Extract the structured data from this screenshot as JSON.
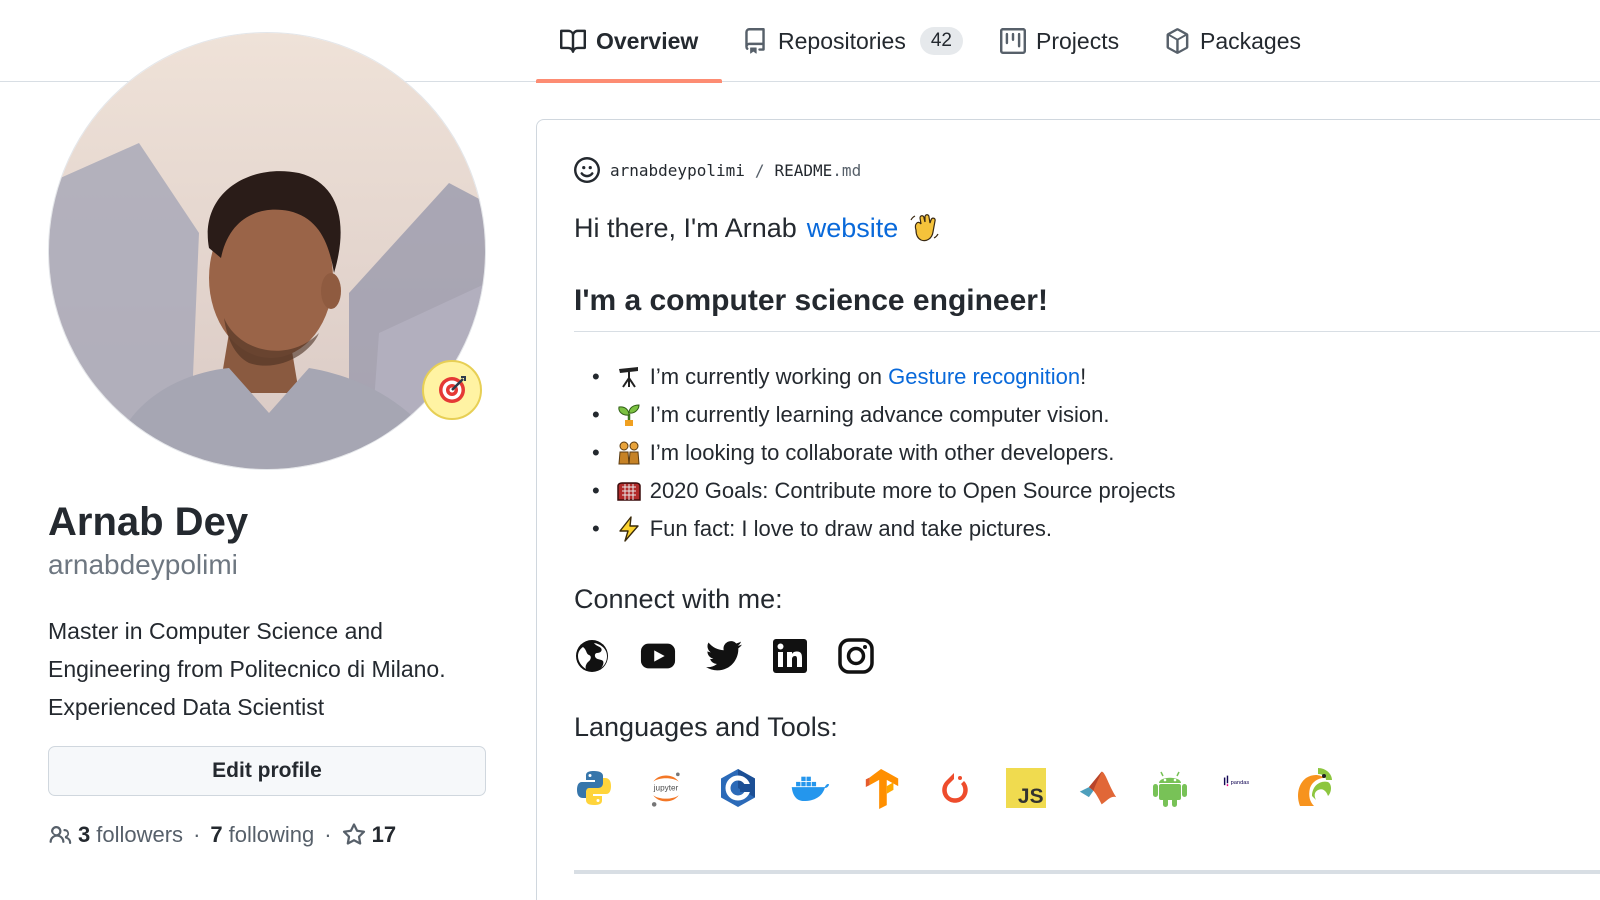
{
  "nav": {
    "tabs": [
      {
        "label": "Overview",
        "icon": "book-icon",
        "active": true
      },
      {
        "label": "Repositories",
        "icon": "repo-icon",
        "count": "42"
      },
      {
        "label": "Projects",
        "icon": "project-icon"
      },
      {
        "label": "Packages",
        "icon": "package-icon"
      }
    ]
  },
  "profile": {
    "full_name": "Arnab Dey",
    "username": "arnabdeypolimi",
    "bio": "Master in Computer Science and Engineering from Politecnico di Milano. Experienced Data Scientist",
    "edit_label": "Edit profile",
    "followers_count": "3",
    "followers_label": "followers",
    "following_count": "7",
    "following_label": "following",
    "stars_count": "17",
    "status_icon": "direct-hit-icon"
  },
  "readme": {
    "owner": "arnabdeypolimi",
    "separator": "/",
    "file": "README",
    "ext": ".md",
    "greeting": "Hi there, I'm Arnab",
    "greeting_link": "website",
    "heading": "I'm a computer science engineer!",
    "bullets": [
      {
        "emoji": "telescope-icon",
        "pre": "I’m currently working on ",
        "link": "Gesture recognition",
        "post": "!"
      },
      {
        "emoji": "seedling-icon",
        "text": "I’m currently learning advance computer vision."
      },
      {
        "emoji": "people-holding-hands-icon",
        "text": "I’m looking to collaborate with other developers."
      },
      {
        "emoji": "goal-net-icon",
        "text": "2020 Goals: Contribute more to Open Source projects"
      },
      {
        "emoji": "lightning-icon",
        "text": "Fun fact: I love to draw and take pictures."
      }
    ],
    "connect_heading": "Connect with me:",
    "social": [
      "globe-icon",
      "youtube-icon",
      "twitter-icon",
      "linkedin-icon",
      "instagram-icon"
    ],
    "tools_heading": "Languages and Tools:",
    "tools": [
      {
        "name": "python-icon"
      },
      {
        "name": "jupyter-icon",
        "label": "jupyter"
      },
      {
        "name": "c-icon"
      },
      {
        "name": "docker-icon"
      },
      {
        "name": "tensorflow-icon"
      },
      {
        "name": "pytorch-icon"
      },
      {
        "name": "javascript-icon",
        "label": "JS"
      },
      {
        "name": "matlab-icon"
      },
      {
        "name": "android-icon"
      },
      {
        "name": "pandas-icon",
        "label": "pandas"
      },
      {
        "name": "opencv-icon"
      }
    ]
  },
  "colors": {
    "link": "#0969da",
    "tab_underline": "#fd8c73",
    "muted": "#57606a"
  }
}
